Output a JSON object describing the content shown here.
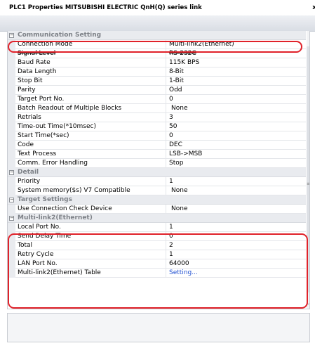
{
  "window": {
    "title": "PLC1 Properties MITSUBISHI ELECTRIC QnH(Q) series link",
    "close_glyph": "x"
  },
  "categories": {
    "communication": "Communication Setting",
    "detail": "Detail",
    "target": "Target Settings",
    "multilink": "Multi-link2(Ethernet)"
  },
  "toggle_glyph": "−",
  "properties": {
    "connection_mode": {
      "name": "Connection Mode",
      "value": "Multi-link2(Ethernet)"
    },
    "signal_level": {
      "name": "Signal Level",
      "value": "RS-232C"
    },
    "baud_rate": {
      "name": "Baud Rate",
      "value": "115K BPS"
    },
    "data_length": {
      "name": "Data Length",
      "value": "8-Bit"
    },
    "stop_bit": {
      "name": "Stop Bit",
      "value": "1-Bit"
    },
    "parity": {
      "name": "Parity",
      "value": "Odd"
    },
    "target_port": {
      "name": "Target Port No.",
      "value": "0"
    },
    "batch_readout": {
      "name": "Batch Readout of Multiple Blocks",
      "value": "None"
    },
    "retrials": {
      "name": "Retrials",
      "value": "3"
    },
    "timeout_time": {
      "name": "Time-out Time(*10msec)",
      "value": "50"
    },
    "start_time": {
      "name": "Start Time(*sec)",
      "value": "0"
    },
    "code": {
      "name": "Code",
      "value": "DEC"
    },
    "text_process": {
      "name": "Text Process",
      "value": "LSB->MSB"
    },
    "comm_error": {
      "name": "Comm. Error Handling",
      "value": "Stop"
    },
    "priority": {
      "name": "Priority",
      "value": "1"
    },
    "system_memory": {
      "name": "System memory($s) V7 Compatible",
      "value": "None"
    },
    "use_conn_check": {
      "name": "Use Connection Check Device",
      "value": "None"
    },
    "local_port": {
      "name": "Local Port No.",
      "value": "1"
    },
    "send_delay": {
      "name": "Send Delay Time",
      "value": "0"
    },
    "total": {
      "name": "Total",
      "value": "2"
    },
    "retry_cycle": {
      "name": "Retry Cycle",
      "value": "1"
    },
    "lan_port": {
      "name": "LAN Port No.",
      "value": "64000"
    },
    "ml2_table": {
      "name": "Multi-link2(Ethernet) Table",
      "value": "Setting..."
    }
  },
  "colors": {
    "highlight": "#e0222a",
    "link": "#1f4fd1",
    "category_bg": "#e9ebef",
    "category_text": "#7d8187"
  }
}
